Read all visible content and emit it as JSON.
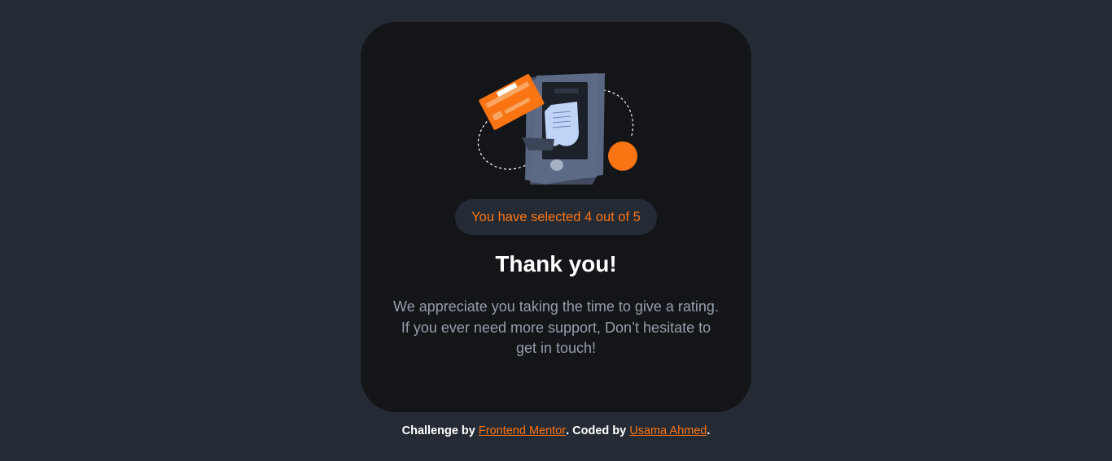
{
  "card": {
    "illustration_name": "payment-phone-illustration",
    "selection_text": "You have selected 4 out of 5",
    "title": "Thank you!",
    "message": "We appreciate you taking the time to give a rating. If you ever need more support, Don’t hesitate to get in touch!"
  },
  "footer": {
    "prefix": "Challenge by ",
    "link1_label": "Frontend Mentor",
    "middle": ". Coded by ",
    "link2_label": "Usama Ahmed",
    "suffix": "."
  },
  "colors": {
    "page_background": "#252b35",
    "card_background": "#131518",
    "accent": "#fb7413",
    "muted_text": "#959eac",
    "pill_background": "#252b35"
  }
}
